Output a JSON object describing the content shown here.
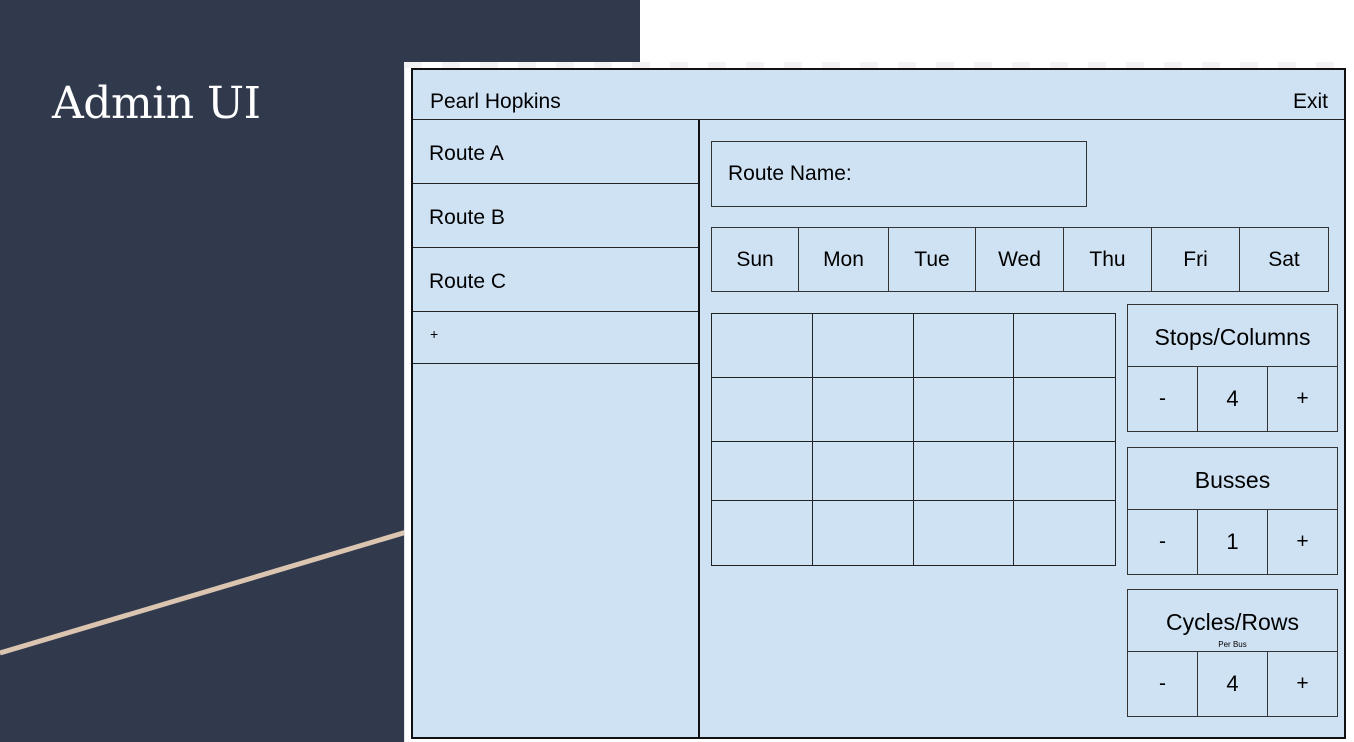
{
  "slide": {
    "title": "Admin UI",
    "colors": {
      "background": "#313a4d",
      "accent_line": "#dcc5b0",
      "mockup_fill": "#cfe2f3"
    }
  },
  "mockup": {
    "user_name": "Pearl Hopkins",
    "exit_label": "Exit",
    "routes": [
      {
        "label": "Route A"
      },
      {
        "label": "Route B"
      },
      {
        "label": "Route C"
      }
    ],
    "add_route_label": "+",
    "route_name_label": "Route Name:",
    "days": [
      "Sun",
      "Mon",
      "Tue",
      "Wed",
      "Thu",
      "Fri",
      "Sat"
    ],
    "grid": {
      "columns": 4,
      "rows": 4
    },
    "steppers": {
      "stops": {
        "title": "Stops/Columns",
        "subtitle": "",
        "decrement": "-",
        "value": "4",
        "increment": "+"
      },
      "busses": {
        "title": "Busses",
        "subtitle": "",
        "decrement": "-",
        "value": "1",
        "increment": "+"
      },
      "cycles": {
        "title": "Cycles/Rows",
        "subtitle": "Per Bus",
        "decrement": "-",
        "value": "4",
        "increment": "+"
      }
    }
  }
}
